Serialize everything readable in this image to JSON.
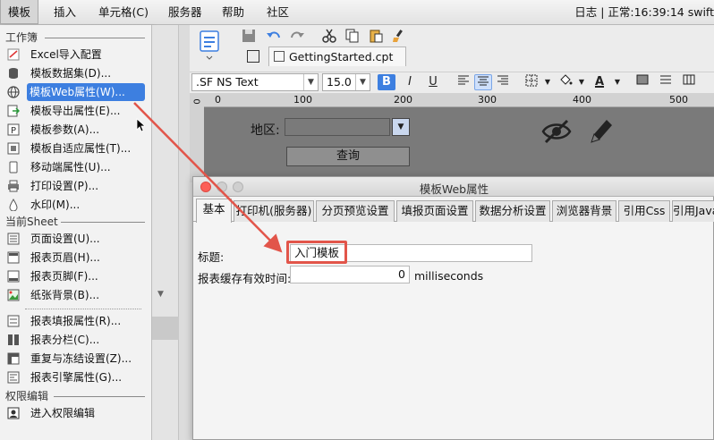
{
  "menubar": {
    "items": [
      "模板",
      "插入",
      "单元格(C)",
      "服务器",
      "帮助",
      "社区"
    ],
    "status": "日志 | 正常:16:39:14 swift"
  },
  "menu": {
    "sec_workbook": "工作簿",
    "sec_sheet": "当前Sheet",
    "sec_perm": "权限编辑",
    "items_workbook": [
      {
        "label": "Excel导入配置",
        "icon": "excel-import-icon"
      },
      {
        "label": "模板数据集(D)...",
        "icon": "database-icon"
      },
      {
        "label": "模板Web属性(W)...",
        "icon": "globe-icon"
      },
      {
        "label": "模板导出属性(E)...",
        "icon": "export-icon"
      },
      {
        "label": "模板参数(A)...",
        "icon": "parameter-icon"
      },
      {
        "label": "模板自适应属性(T)...",
        "icon": "adaptive-icon"
      },
      {
        "label": "移动端属性(U)...",
        "icon": "mobile-icon"
      },
      {
        "label": "打印设置(P)...",
        "icon": "printer-icon"
      },
      {
        "label": "水印(M)...",
        "icon": "watermark-icon"
      }
    ],
    "items_sheet": [
      {
        "label": "页面设置(U)...",
        "icon": "page-setup-icon"
      },
      {
        "label": "报表页眉(H)...",
        "icon": "header-icon"
      },
      {
        "label": "报表页脚(F)...",
        "icon": "footer-icon"
      },
      {
        "label": "纸张背景(B)...",
        "icon": "background-image-icon"
      },
      {
        "label": "报表填报属性(R)...",
        "icon": "fill-property-icon"
      },
      {
        "label": "报表分栏(C)...",
        "icon": "columns-icon"
      },
      {
        "label": "重复与冻结设置(Z)...",
        "icon": "freeze-icon"
      },
      {
        "label": "报表引擎属性(G)...",
        "icon": "engine-icon"
      }
    ],
    "items_perm": [
      {
        "label": "进入权限编辑",
        "icon": "permission-icon"
      }
    ]
  },
  "file_tab": {
    "name": "GettingStarted.cpt"
  },
  "format": {
    "font": ".SF NS Text",
    "size": "15.0",
    "bold": "B",
    "italic": "I",
    "underline": "U",
    "color_letter": "A"
  },
  "ruler": {
    "marks": [
      "0",
      "100",
      "200",
      "300",
      "400",
      "500"
    ],
    "vmark": "0"
  },
  "canvas": {
    "area_label": "地区:",
    "query_button": "查询"
  },
  "dialog": {
    "title": "模板Web属性",
    "tabs": [
      "基本",
      "打印机(服务器)",
      "分页预览设置",
      "填报页面设置",
      "数据分析设置",
      "浏览器背景",
      "引用Css",
      "引用Java"
    ],
    "title_label": "标题:",
    "title_value": "入门模板",
    "cache_label": "报表缓存有效时间:",
    "cache_value": "0",
    "cache_unit": "milliseconds"
  },
  "colors": {
    "accent": "#3d7fe0",
    "annotation": "#e2554a"
  }
}
